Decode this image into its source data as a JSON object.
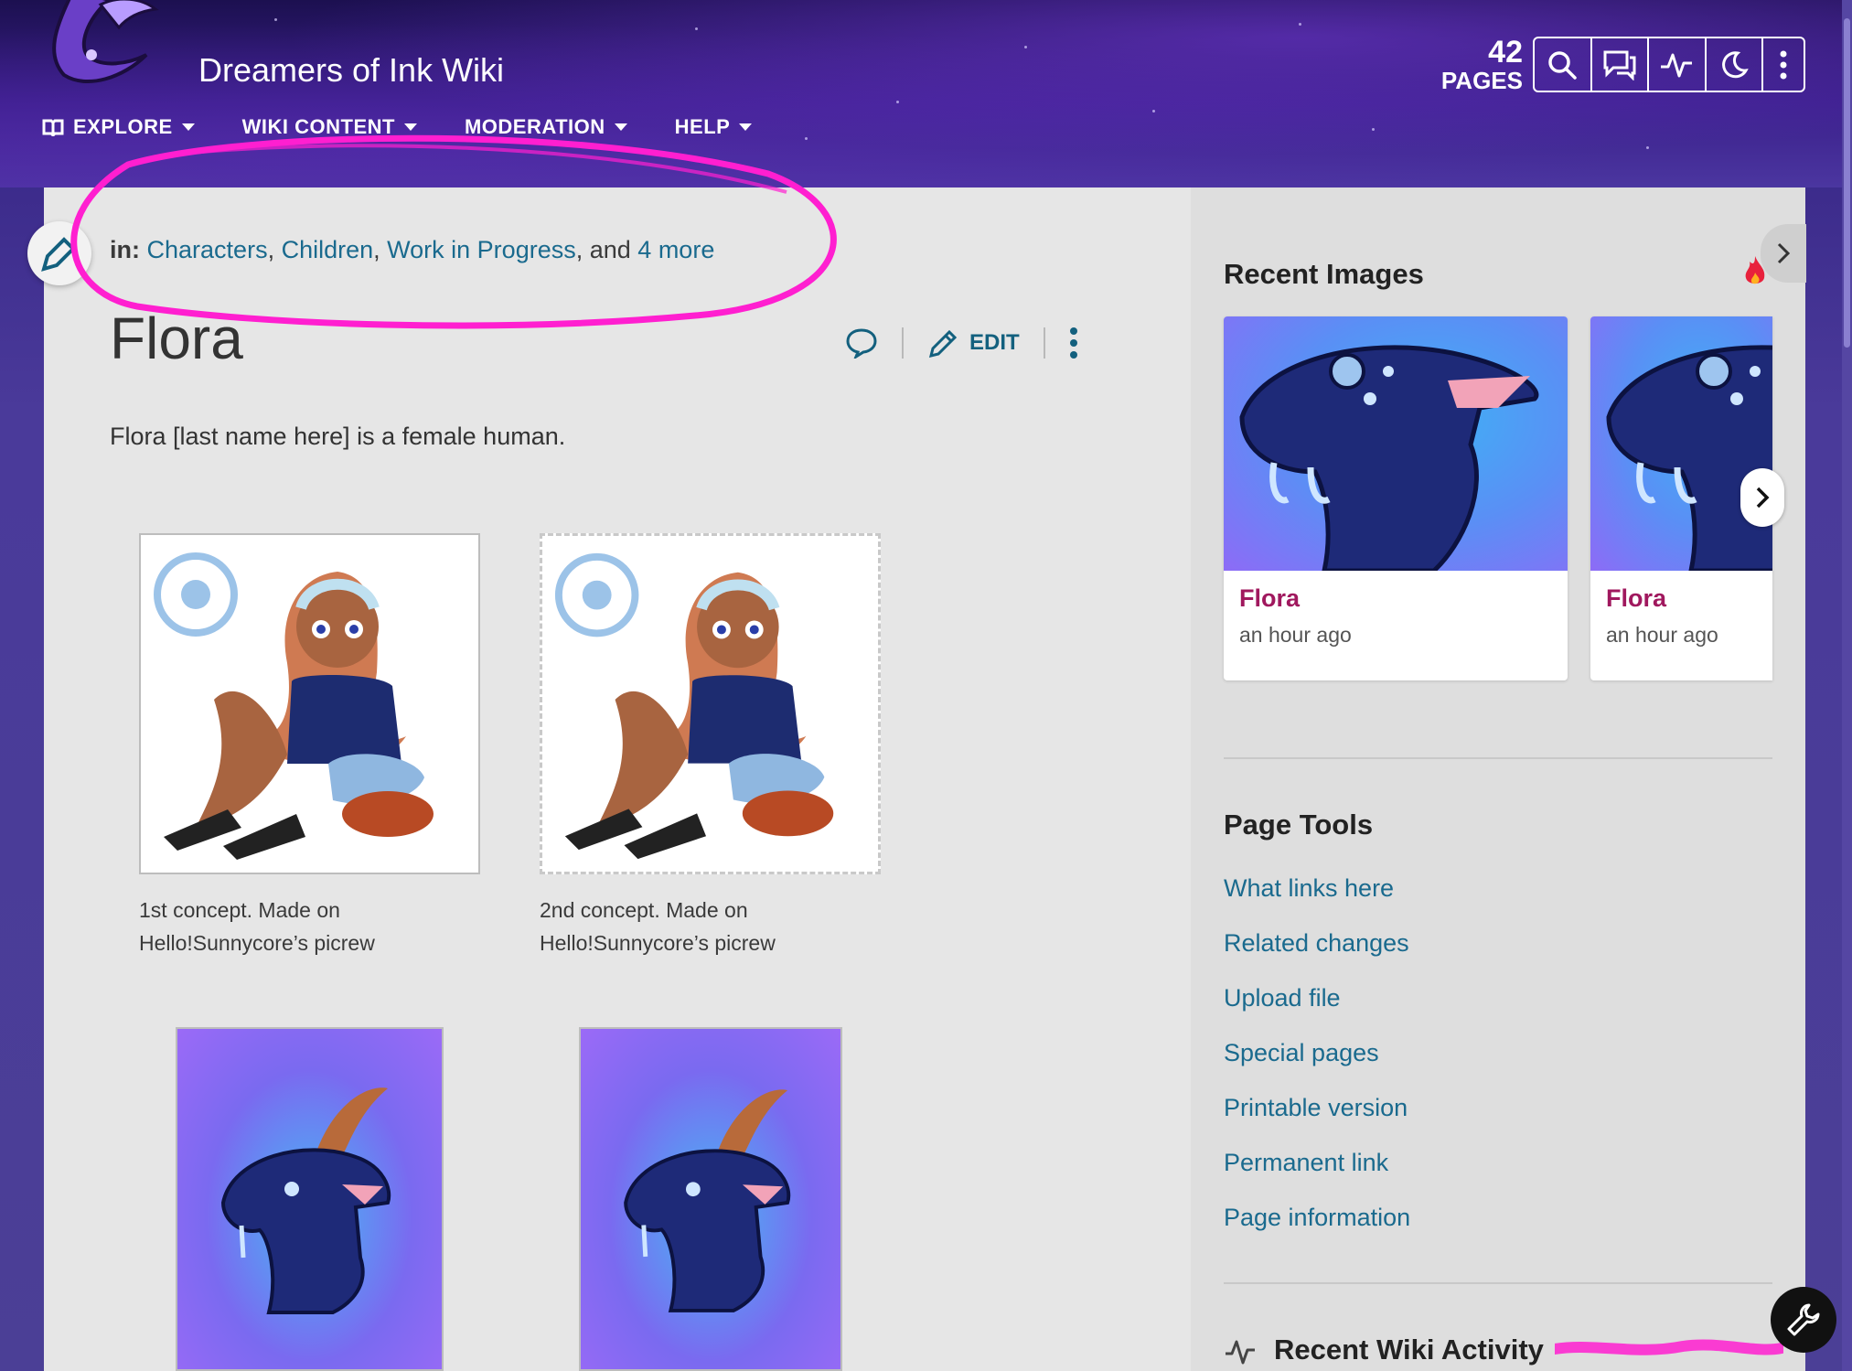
{
  "header": {
    "wiki_name": "Dreamers of Ink Wiki",
    "pages_count": "42",
    "pages_label": "PAGES",
    "nav": [
      {
        "label": "EXPLORE"
      },
      {
        "label": "WIKI CONTENT"
      },
      {
        "label": "MODERATION"
      },
      {
        "label": "HELP"
      }
    ],
    "tools": [
      "search-icon",
      "discussions-icon",
      "activity-icon",
      "dark-mode-icon",
      "more-icon"
    ]
  },
  "article": {
    "categories_prefix": "in:",
    "categories": [
      "Characters",
      "Children",
      "Work in Progress"
    ],
    "categories_and": ", and",
    "categories_more": "4 more",
    "title": "Flora",
    "edit_label": "EDIT",
    "intro": "Flora [last name here] is a female human.",
    "gallery": [
      {
        "caption_line1": "1st concept. Made on",
        "caption_line2": "Hello!Sunnycore’s picrew"
      },
      {
        "caption_line1": "2nd concept. Made on",
        "caption_line2": "Hello!Sunnycore’s picrew"
      }
    ]
  },
  "sidebar": {
    "recent_images_title": "Recent Images",
    "recent_images": [
      {
        "title": "Flora",
        "time": "an hour ago"
      },
      {
        "title": "Flora",
        "time": "an hour ago"
      }
    ],
    "page_tools_title": "Page Tools",
    "page_tools": [
      "What links here",
      "Related changes",
      "Upload file",
      "Special pages",
      "Printable version",
      "Permanent link",
      "Page information"
    ],
    "recent_activity_title": "Recent Wiki Activity"
  },
  "colors": {
    "link": "#1a6a8e",
    "image_title": "#a0185e",
    "annotation": "#ff1fd0"
  }
}
